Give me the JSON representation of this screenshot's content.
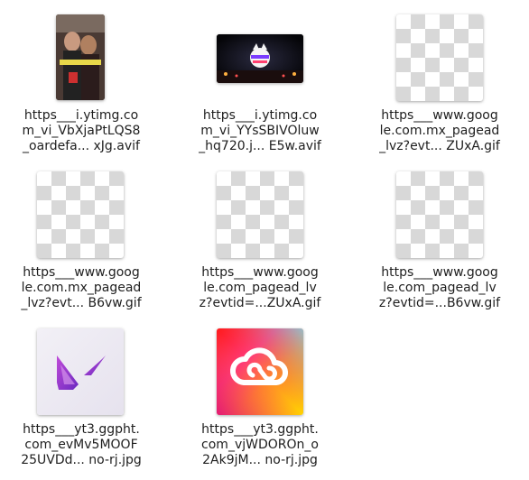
{
  "files": [
    {
      "line1": "https___i.ytimg.co",
      "line2": "m_vi_VbXjaPtLQS8",
      "line3": "_oardefa... xJg.avif",
      "thumb": "photo-thumbnail"
    },
    {
      "line1": "https___i.ytimg.co",
      "line2": "m_vi_YYsSBIVOluw",
      "line3": "_hq720.j... E5w.avif",
      "thumb": "banner-thumbnail"
    },
    {
      "line1": "https___www.goog",
      "line2": "le.com.mx_pagead",
      "line3": "_lvz?evt... ZUxA.gif",
      "thumb": "transparent-thumbnail"
    },
    {
      "line1": "https___www.goog",
      "line2": "le.com.mx_pagead",
      "line3": "_lvz?evt... B6vw.gif",
      "thumb": "transparent-thumbnail"
    },
    {
      "line1": "https___www.goog",
      "line2": "le.com_pagead_lv",
      "line3": "z?evtid=...ZUxA.gif",
      "thumb": "transparent-thumbnail"
    },
    {
      "line1": "https___www.goog",
      "line2": "le.com_pagead_lv",
      "line3": "z?evtid=...B6vw.gif",
      "thumb": "transparent-thumbnail"
    },
    {
      "line1": "https___yt3.ggpht.",
      "line2": "com_evMv5MOOF",
      "line3": "25UVDd... no-rj.jpg",
      "thumb": "valorant-logo-thumbnail"
    },
    {
      "line1": "https___yt3.ggpht.",
      "line2": "com_vjWDOROn_o",
      "line3": "2Ak9jM... no-rj.jpg",
      "thumb": "creative-cloud-logo-thumbnail"
    }
  ]
}
